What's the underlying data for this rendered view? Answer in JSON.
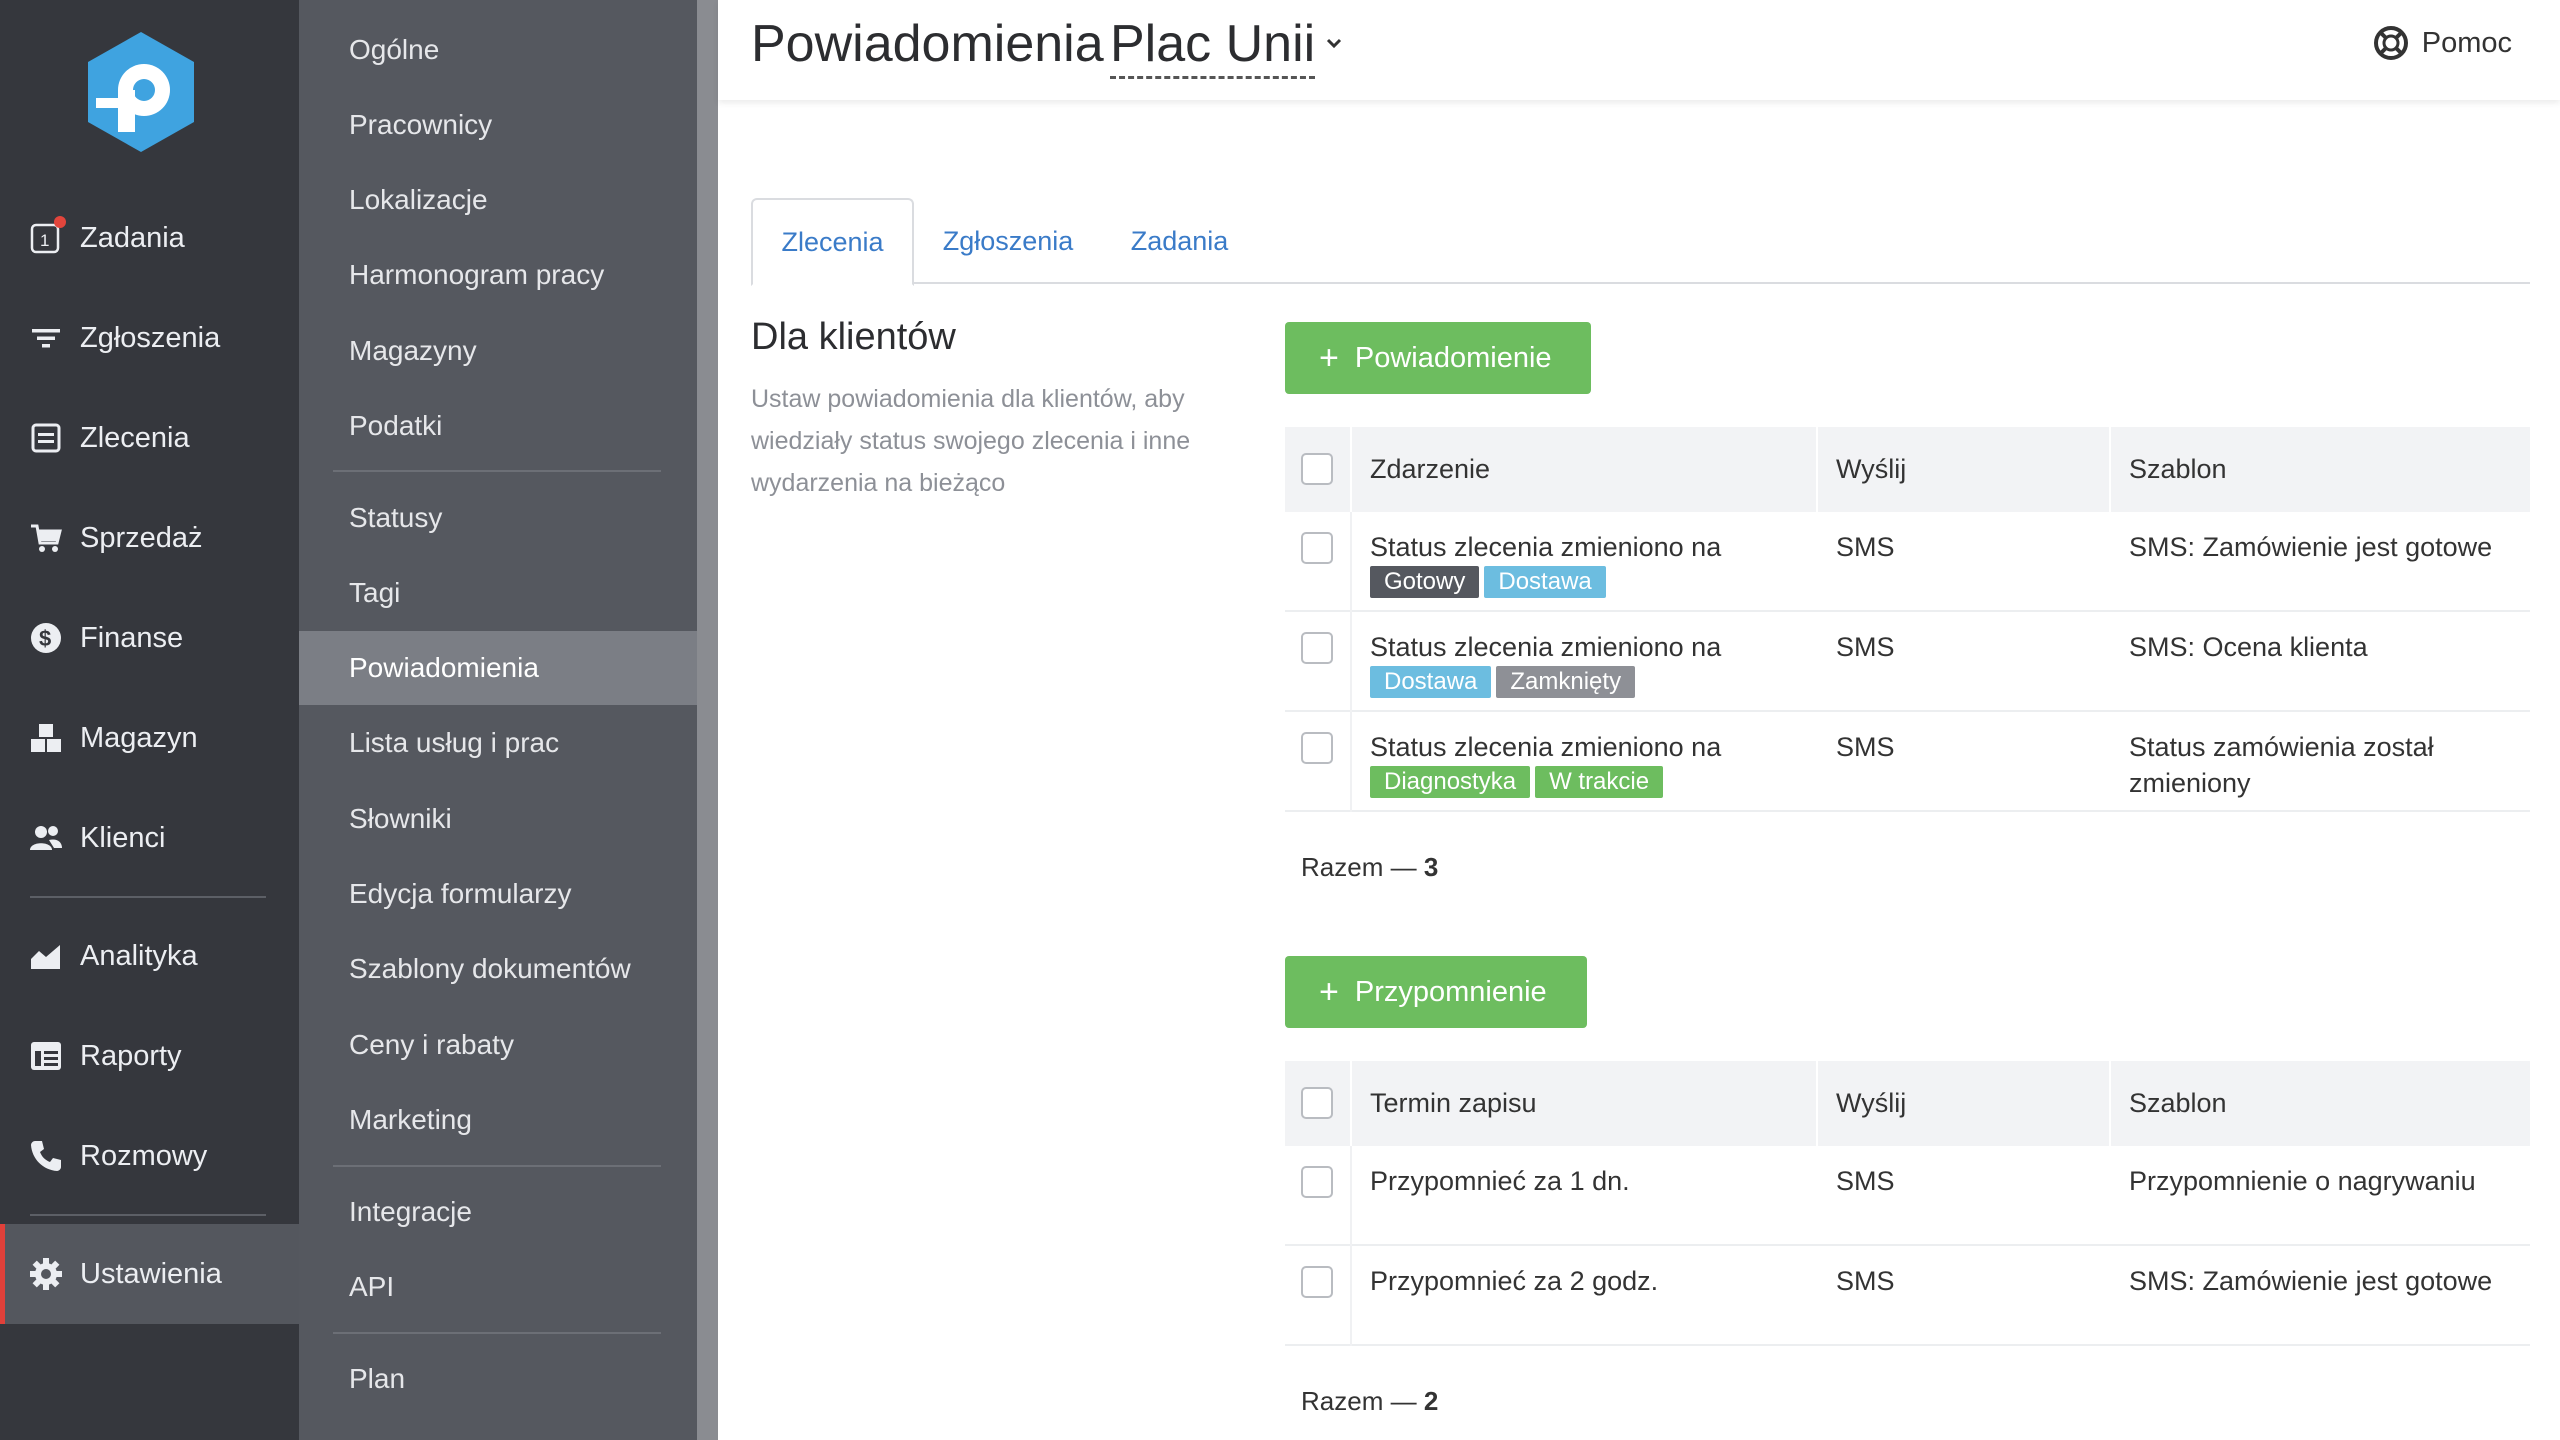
{
  "nav": {
    "items": [
      {
        "label": "Zadania",
        "icon": "tasks-icon"
      },
      {
        "label": "Zgłoszenia",
        "icon": "filter-icon"
      },
      {
        "label": "Zlecenia",
        "icon": "orders-icon"
      },
      {
        "label": "Sprzedaż",
        "icon": "cart-icon"
      },
      {
        "label": "Finanse",
        "icon": "dollar-icon"
      },
      {
        "label": "Magazyn",
        "icon": "boxes-icon"
      },
      {
        "label": "Klienci",
        "icon": "clients-icon"
      },
      {
        "label": "Analityka",
        "icon": "chart-icon"
      },
      {
        "label": "Raporty",
        "icon": "reports-icon"
      },
      {
        "label": "Rozmowy",
        "icon": "phone-icon"
      },
      {
        "label": "Ustawienia",
        "icon": "gear-icon"
      }
    ],
    "tasks_badge": "1",
    "active": "Ustawienia"
  },
  "settings_menu": {
    "items": [
      "Ogólne",
      "Pracownicy",
      "Lokalizacje",
      "Harmonogram pracy",
      "Magazyny",
      "Podatki",
      "Statusy",
      "Tagi",
      "Powiadomienia",
      "Lista usług i prac",
      "Słowniki",
      "Edycja formularzy",
      "Szablony dokumentów",
      "Ceny i rabaty",
      "Marketing",
      "Integracje",
      "API",
      "Plan"
    ],
    "active": "Powiadomienia"
  },
  "header": {
    "title": "Powiadomienia",
    "location": "Plac Unii",
    "help_label": "Pomoc"
  },
  "tabs": [
    "Zlecenia",
    "Zgłoszenia",
    "Zadania"
  ],
  "active_tab": "Zlecenia",
  "section": {
    "title": "Dla klientów",
    "description": "Ustaw powiadomienia dla klientów, aby wiedziały status swojego zlecenia i inne wydarzenia na bieżąco"
  },
  "notifications": {
    "button_label": "Powiadomienie",
    "columns": [
      "Zdarzenie",
      "Wyślij",
      "Szablon"
    ],
    "rows": [
      {
        "event": "Status zlecenia zmieniono na",
        "tags": [
          {
            "label": "Gotowy",
            "color": "#55585f"
          },
          {
            "label": "Dostawa",
            "color": "#6cbde0"
          }
        ],
        "send": "SMS",
        "template": "SMS: Zamówienie jest gotowe"
      },
      {
        "event": "Status zlecenia zmieniono na",
        "tags": [
          {
            "label": "Dostawa",
            "color": "#6cbde0"
          },
          {
            "label": "Zamknięty",
            "color": "#8e9096"
          }
        ],
        "send": "SMS",
        "template": "SMS: Ocena klienta"
      },
      {
        "event": "Status zlecenia zmieniono na",
        "tags": [
          {
            "label": "Diagnostyka",
            "color": "#6dbd5f"
          },
          {
            "label": "W trakcie",
            "color": "#6dbd5f"
          }
        ],
        "send": "SMS",
        "template": "Status zamówienia został zmieniony"
      }
    ],
    "total_label": "Razem —",
    "total_count": "3"
  },
  "reminders": {
    "button_label": "Przypomnienie",
    "columns": [
      "Termin zapisu",
      "Wyślij",
      "Szablon"
    ],
    "rows": [
      {
        "term": "Przypomnieć za 1 dn.",
        "send": "SMS",
        "template": "Przypomnienie o nagrywaniu"
      },
      {
        "term": "Przypomnieć za 2 godz.",
        "send": "SMS",
        "template": "SMS: Zamówienie jest gotowe"
      }
    ],
    "total_label": "Razem —",
    "total_count": "2"
  },
  "colors": {
    "nav_bg": "#35373d",
    "submenu_bg": "#55585f",
    "accent_green": "#6dbd5f",
    "accent_red": "#e0403a",
    "link_blue": "#3a7bc8"
  }
}
